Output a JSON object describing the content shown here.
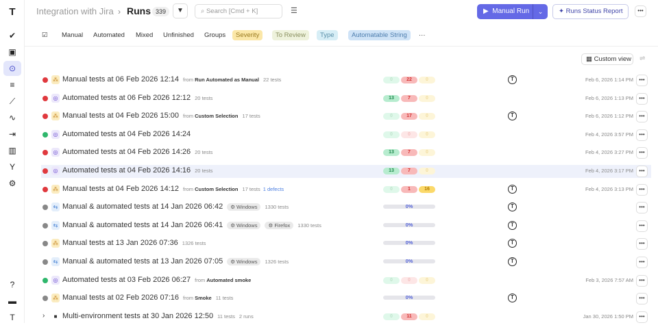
{
  "sidebar": {
    "logo": "T",
    "items": [
      {
        "icon": "check-icon",
        "glyph": "✔"
      },
      {
        "icon": "clipboard-icon",
        "glyph": "▣"
      },
      {
        "icon": "play-circle-icon",
        "glyph": "⊙",
        "active": true
      },
      {
        "icon": "list-check-icon",
        "glyph": "≡"
      },
      {
        "icon": "steps-icon",
        "glyph": "⟋"
      },
      {
        "icon": "pulse-icon",
        "glyph": "∿"
      },
      {
        "icon": "import-icon",
        "glyph": "⇥"
      },
      {
        "icon": "chart-icon",
        "glyph": "▥"
      },
      {
        "icon": "branch-icon",
        "glyph": "Y"
      },
      {
        "icon": "gear-icon",
        "glyph": "⚙"
      }
    ],
    "bottom": [
      {
        "icon": "help-icon",
        "glyph": "?"
      },
      {
        "icon": "folder-icon",
        "glyph": "▬"
      },
      {
        "icon": "avatar-icon",
        "glyph": "T"
      }
    ]
  },
  "header": {
    "project": "Integration with Jira",
    "separator": "›",
    "title": "Runs",
    "count": "339",
    "search_placeholder": "Search [Cmd + K]",
    "manual_run": "Manual Run",
    "report": "Runs Status Report"
  },
  "tabs": [
    {
      "label": "Manual"
    },
    {
      "label": "Automated"
    },
    {
      "label": "Mixed"
    },
    {
      "label": "Unfinished"
    },
    {
      "label": "Groups"
    },
    {
      "label": "Severity",
      "bg": "#fbe7a8",
      "color": "#9a7a20"
    },
    {
      "label": "To Review",
      "bg": "#eef2dc",
      "color": "#8a9060"
    },
    {
      "label": "Type",
      "bg": "#d7eef6",
      "color": "#5a8fa8"
    },
    {
      "label": "Automatable String",
      "bg": "#cfe3f7",
      "color": "#4e7eae"
    }
  ],
  "custom_view": "Custom view",
  "colors": {
    "failed": "#e0393e",
    "passed": "#2fb76c",
    "pending": "#888888",
    "accent": "#6469e6"
  },
  "runs": [
    {
      "status": "failed",
      "type": "manual",
      "title": "Manual tests at 06 Feb 2026 12:14",
      "from": "Run Automated as Manual",
      "tests": "22 tests",
      "stats": [
        "0",
        "22",
        "0"
      ],
      "avatar": true,
      "date": "Feb 6, 2026 1:14 PM"
    },
    {
      "status": "failed",
      "type": "automated",
      "title": "Automated tests at 06 Feb 2026 12:12",
      "tests": "20 tests",
      "stats": [
        "13",
        "7",
        "0"
      ],
      "date": "Feb 6, 2026 1:13 PM"
    },
    {
      "status": "failed",
      "type": "manual",
      "title": "Manual tests at 04 Feb 2026 15:00",
      "from": "Custom Selection",
      "tests": "17 tests",
      "stats": [
        "0",
        "17",
        "0"
      ],
      "avatar": true,
      "date": "Feb 6, 2026 1:12 PM"
    },
    {
      "status": "passed",
      "type": "automated",
      "title": "Automated tests at 04 Feb 2026 14:24",
      "stats": [
        "0",
        "0",
        "0"
      ],
      "date": "Feb 4, 2026 3:57 PM"
    },
    {
      "status": "failed",
      "type": "automated",
      "title": "Automated tests at 04 Feb 2026 14:26",
      "tests": "20 tests",
      "stats": [
        "13",
        "7",
        "0"
      ],
      "date": "Feb 4, 2026 3:27 PM"
    },
    {
      "status": "failed",
      "type": "automated",
      "title": "Automated tests at 04 Feb 2026 14:16",
      "tests": "20 tests",
      "stats": [
        "13",
        "7",
        "0"
      ],
      "date": "Feb 4, 2026 3:17 PM",
      "highlighted": true
    },
    {
      "status": "failed",
      "type": "manual",
      "title": "Manual tests at 04 Feb 2026 14:12",
      "from": "Custom Selection",
      "tests": "17 tests",
      "defects": "1 defects",
      "stats": [
        "0",
        "1",
        "16"
      ],
      "avatar": true,
      "date": "Feb 4, 2026 3:13 PM"
    },
    {
      "status": "pending",
      "type": "mixed",
      "title": "Manual & automated tests at 14 Jan 2026 06:42",
      "envs": [
        "Windows"
      ],
      "tests": "1330 tests",
      "progress": "0%",
      "avatar": true
    },
    {
      "status": "pending",
      "type": "mixed",
      "title": "Manual & automated tests at 14 Jan 2026 06:41",
      "envs": [
        "Windows",
        "Firefox"
      ],
      "tests": "1330 tests",
      "progress": "0%",
      "avatar": true
    },
    {
      "status": "pending",
      "type": "manual",
      "title": "Manual tests at 13 Jan 2026 07:36",
      "tests": "1326 tests",
      "progress": "0%",
      "avatar": true
    },
    {
      "status": "pending",
      "type": "mixed",
      "title": "Manual & automated tests at 13 Jan 2026 07:05",
      "envs": [
        "Windows"
      ],
      "tests": "1326 tests",
      "progress": "0%",
      "avatar": true
    },
    {
      "status": "passed",
      "type": "automated",
      "title": "Automated tests at 03 Feb 2026 06:27",
      "from": "Automated smoke",
      "stats": [
        "0",
        "0",
        "0"
      ],
      "date": "Feb 3, 2026 7:57 AM"
    },
    {
      "status": "pending",
      "type": "manual",
      "title": "Manual tests at 02 Feb 2026 07:16",
      "from": "Smoke",
      "tests": "11 tests",
      "progress": "0%",
      "avatar": true
    },
    {
      "status": "group",
      "type": "folder",
      "title": "Multi-environment tests at 30 Jan 2026 12:50",
      "tests": "11 tests",
      "runs": "2 runs",
      "stats": [
        "0",
        "11",
        "0"
      ],
      "date": "Jan 30, 2026 1:50 PM"
    }
  ],
  "from_label": "from"
}
